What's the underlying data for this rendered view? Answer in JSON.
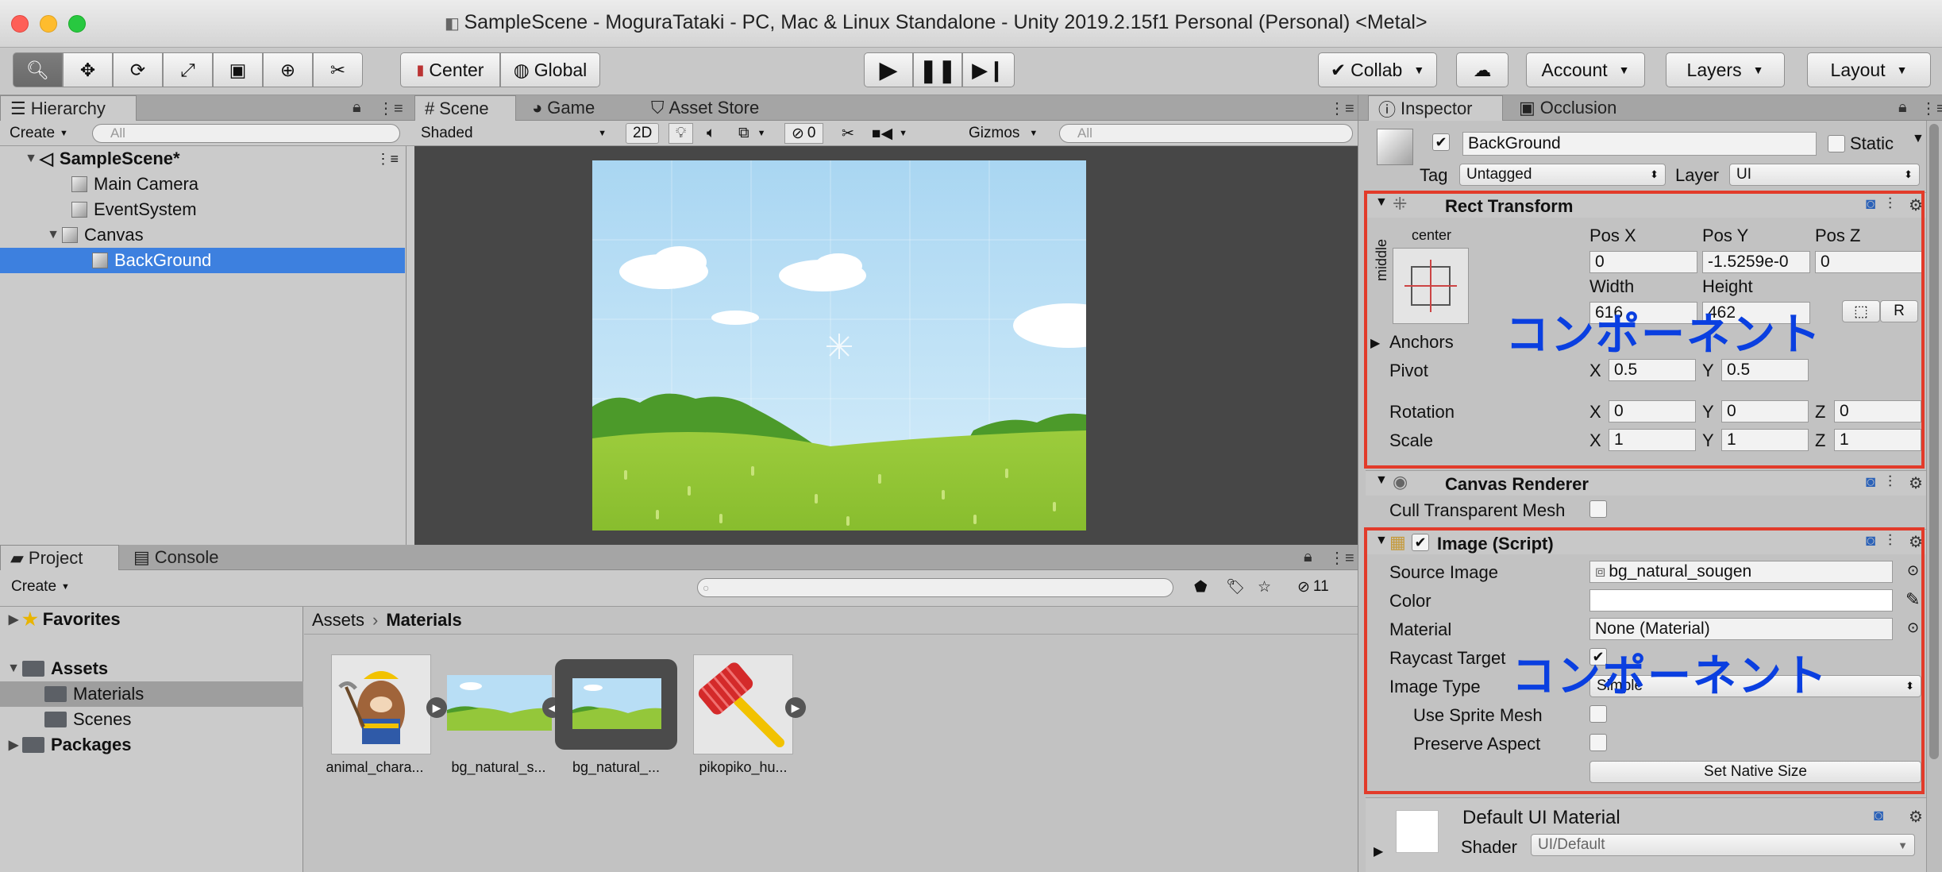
{
  "window": {
    "title": "SampleScene - MoguraTataki - PC, Mac & Linux Standalone - Unity 2019.2.15f1 Personal (Personal) <Metal>"
  },
  "toolbar": {
    "center": "Center",
    "global": "Global",
    "collab": "Collab",
    "account": "Account",
    "layers": "Layers",
    "layout": "Layout"
  },
  "hierarchy": {
    "tab": "Hierarchy",
    "create": "Create",
    "search_placeholder": "All",
    "scene": "SampleScene*",
    "items": [
      "Main Camera",
      "EventSystem",
      "Canvas",
      "BackGround"
    ]
  },
  "scene": {
    "tabs": [
      "Scene",
      "Game",
      "Asset Store"
    ],
    "shading": "Shaded",
    "mode2d": "2D",
    "hidden_count": "0",
    "gizmos": "Gizmos",
    "search_placeholder": "All"
  },
  "inspector": {
    "tabs": [
      "Inspector",
      "Occlusion"
    ],
    "object_name": "BackGround",
    "static": "Static",
    "tag_label": "Tag",
    "tag": "Untagged",
    "layer_label": "Layer",
    "layer": "UI",
    "rect": {
      "title": "Rect Transform",
      "anchor_h": "center",
      "anchor_v": "middle",
      "posx_label": "Pos X",
      "posy_label": "Pos Y",
      "posz_label": "Pos Z",
      "posx": "0",
      "posy": "-1.5259e-0",
      "posz": "0",
      "width_label": "Width",
      "height_label": "Height",
      "width": "616",
      "height": "462",
      "anchors": "Anchors",
      "pivot": "Pivot",
      "pivot_x": "0.5",
      "pivot_y": "0.5",
      "rotation": "Rotation",
      "rot_x": "0",
      "rot_y": "0",
      "rot_z": "0",
      "scale": "Scale",
      "scale_x": "1",
      "scale_y": "1",
      "scale_z": "1",
      "x": "X",
      "y": "Y",
      "z": "Z",
      "r_btn": "R"
    },
    "canvas_renderer": {
      "title": "Canvas Renderer",
      "cull": "Cull Transparent Mesh"
    },
    "image": {
      "title": "Image (Script)",
      "source_label": "Source Image",
      "source": "bg_natural_sougen",
      "color_label": "Color",
      "material_label": "Material",
      "material": "None (Material)",
      "raycast": "Raycast Target",
      "type_label": "Image Type",
      "type": "Simple",
      "use_sprite_mesh": "Use Sprite Mesh",
      "preserve": "Preserve Aspect",
      "native": "Set Native Size"
    },
    "default_material": {
      "title": "Default UI Material",
      "shader_label": "Shader",
      "shader": "UI/Default"
    },
    "annotation": "コンポーネント"
  },
  "project": {
    "tabs": [
      "Project",
      "Console"
    ],
    "create": "Create",
    "hidden_count": "11",
    "tree": [
      "Favorites",
      "Assets",
      "Materials",
      "Scenes",
      "Packages"
    ],
    "breadcrumb": [
      "Assets",
      "Materials"
    ],
    "assets": [
      "animal_chara...",
      "bg_natural_s...",
      "bg_natural_...",
      "pikopiko_hu..."
    ]
  },
  "colors": {
    "selection": "#3d80df",
    "annotation_red": "#e23b2a",
    "annotation_blue": "#0a3fe0"
  }
}
